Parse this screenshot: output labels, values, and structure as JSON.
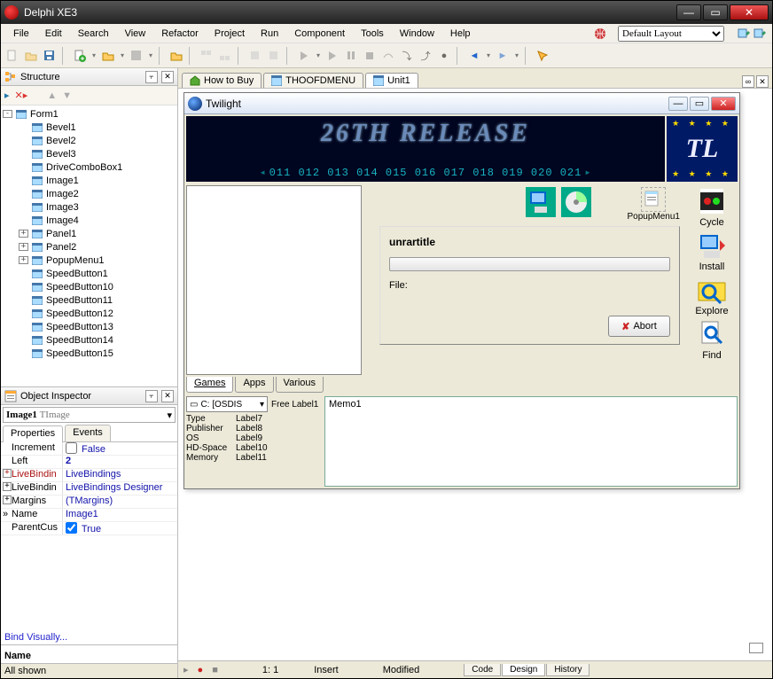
{
  "app": {
    "title": "Delphi XE3"
  },
  "menu": [
    "File",
    "Edit",
    "Search",
    "View",
    "Refactor",
    "Project",
    "Run",
    "Component",
    "Tools",
    "Window",
    "Help"
  ],
  "layout_combo": "Default Layout",
  "structure": {
    "title": "Structure",
    "root": "Form1",
    "items": [
      "Bevel1",
      "Bevel2",
      "Bevel3",
      "DriveComboBox1",
      "Image1",
      "Image2",
      "Image3",
      "Image4",
      "Panel1",
      "Panel2",
      "PopupMenu1",
      "SpeedButton1",
      "SpeedButton10",
      "SpeedButton11",
      "SpeedButton12",
      "SpeedButton13",
      "SpeedButton14",
      "SpeedButton15"
    ],
    "expandable": [
      8,
      9,
      10
    ]
  },
  "inspector": {
    "title": "Object Inspector",
    "obj_name": "Image1",
    "obj_type": "TImage",
    "tabs": [
      "Properties",
      "Events"
    ],
    "props": [
      {
        "k": "Increment",
        "v": "False",
        "chk": true
      },
      {
        "k": "Left",
        "v": "2",
        "bold": true
      },
      {
        "k": "LiveBindin",
        "v": "LiveBindings",
        "red": true,
        "link": true,
        "exp": true
      },
      {
        "k": "LiveBindin",
        "v": "LiveBindings Designer",
        "link": true,
        "exp": true
      },
      {
        "k": "Margins",
        "v": "(TMargins)",
        "link": true,
        "exp": true
      },
      {
        "k": "Name",
        "v": "Image1",
        "sel": true
      },
      {
        "k": "ParentCus",
        "v": "True",
        "chk": true,
        "checked": true
      }
    ],
    "bind": "Bind Visually...",
    "section": "Name",
    "status": "All shown"
  },
  "file_tabs": [
    {
      "label": "How to Buy",
      "icon": "home"
    },
    {
      "label": "THOOFDMENU",
      "icon": "form"
    },
    {
      "label": "Unit1",
      "icon": "form",
      "active": true
    }
  ],
  "dform": {
    "title": "Twilight",
    "banner_title": "26TH RELEASE",
    "banner_nums": [
      "011",
      "012",
      "013",
      "014",
      "015",
      "016",
      "017",
      "018",
      "019",
      "020",
      "021"
    ],
    "logo": "TL",
    "popup_label": "PopupMenu1",
    "unrar_title": "unrartitle",
    "file_label": "File:",
    "abort": "Abort",
    "right_buttons": [
      "Cycle",
      "Install",
      "Explore",
      "Find"
    ],
    "mini_tabs": [
      "Games",
      "Apps",
      "Various"
    ],
    "drive": "C: [OSDIS",
    "free_label": "Free Label1",
    "info_keys": [
      "Type",
      "Publisher",
      "OS",
      "HD-Space",
      "Memory"
    ],
    "info_vals": [
      "Label7",
      "Label8",
      "Label9",
      "Label10",
      "Label11"
    ],
    "memo": "Memo1"
  },
  "statusbar": {
    "pos": "1:   1",
    "mode": "Insert",
    "mod": "Modified",
    "tabs": [
      "Code",
      "Design",
      "History"
    ]
  }
}
